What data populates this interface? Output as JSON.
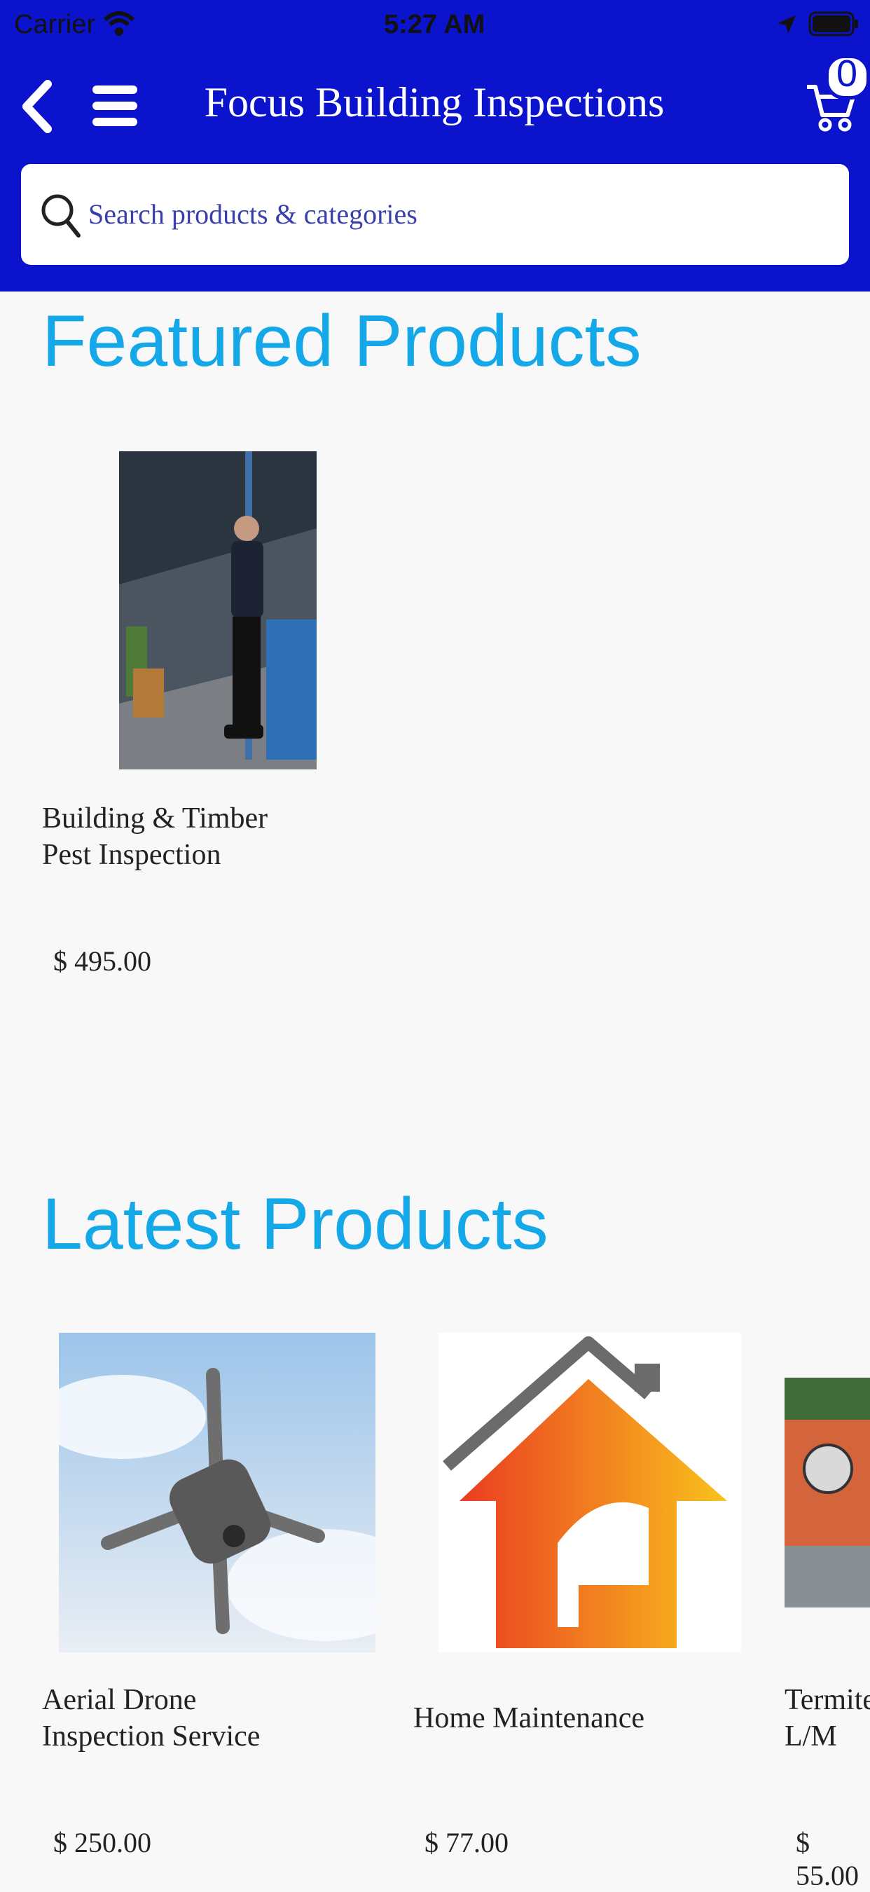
{
  "status_bar": {
    "carrier": "Carrier",
    "time": "5:27 AM"
  },
  "header": {
    "title": "Focus Building Inspections",
    "cart_count": "0",
    "accent": "#0b14cc"
  },
  "search": {
    "placeholder": "Search products & categories"
  },
  "featured": {
    "title": "Featured Products",
    "items": [
      {
        "name_line1": "Building & Timber",
        "name_line2": "Pest Inspection",
        "price": "$ 495.00"
      }
    ]
  },
  "latest": {
    "title": "Latest Products",
    "items": [
      {
        "name_line1": "Aerial Drone",
        "name_line2": "Inspection Service",
        "price": "$ 250.00"
      },
      {
        "name_line1": "Home Maintenance",
        "name_line2": "",
        "price": "$ 77.00"
      },
      {
        "name_line1": "Termite",
        "name_line2": "L/M",
        "price": "$ 55.00"
      }
    ]
  },
  "colors": {
    "section_title": "#15a8e8",
    "background": "#f8f8f8"
  },
  "icons": [
    "back-icon",
    "menu-icon",
    "cart-icon",
    "search-icon",
    "wifi-icon",
    "location-icon",
    "battery-icon"
  ]
}
